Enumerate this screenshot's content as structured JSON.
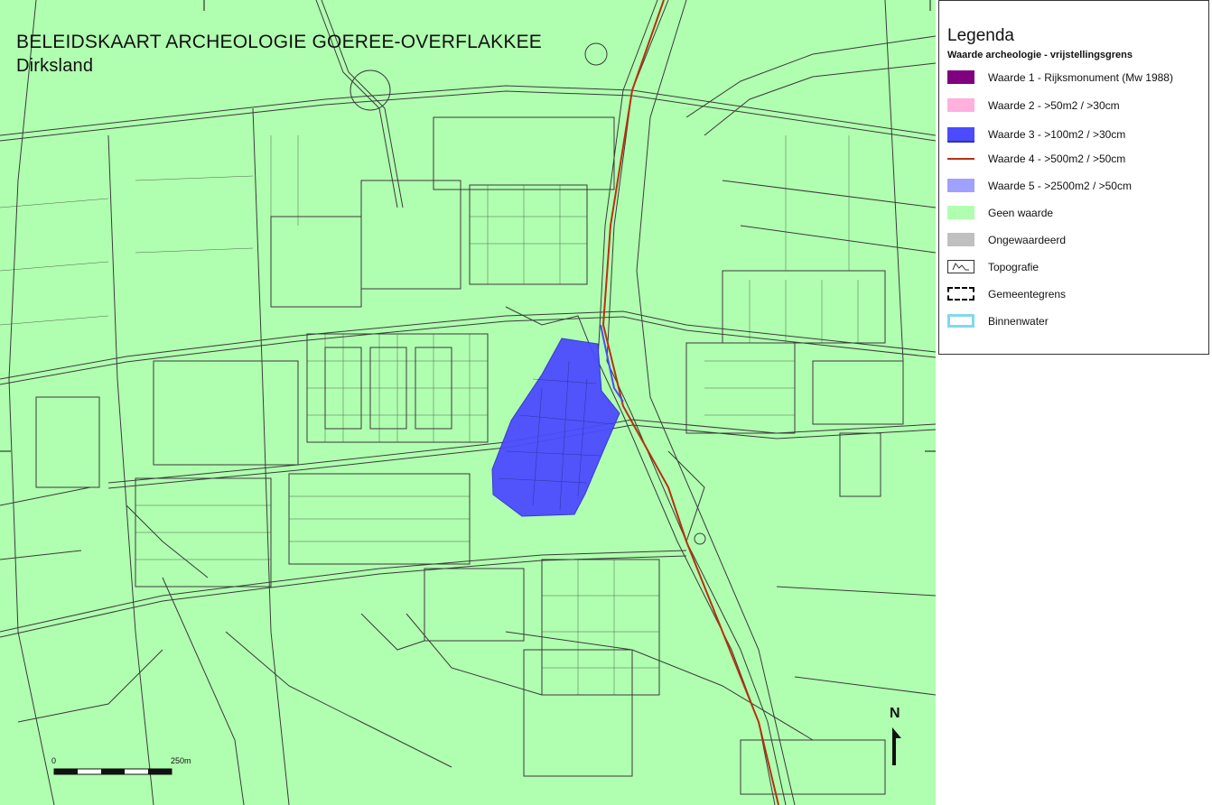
{
  "map": {
    "title": "BELEIDSKAART ARCHEOLOGIE GOEREE-OVERFLAKKEE",
    "subtitle": "Dirksland",
    "background_color": "#b0ffb0",
    "line_color": "#3a3a3a",
    "scale": {
      "start_label": "0",
      "end_label": "250m"
    },
    "north_label": "N"
  },
  "legend": {
    "title": "Legenda",
    "subtitle": "Waarde archeologie - vrijstellingsgrens",
    "items": [
      {
        "label": "Waarde 1 - Rijksmonument (Mw 1988)",
        "color": "#800080",
        "icon": "solid-swatch"
      },
      {
        "label": "Waarde 2 - >50m2 / >30cm",
        "color": "#ffb0dd",
        "icon": "solid-swatch"
      },
      {
        "label": "Waarde 3 - >100m2 / >30cm",
        "color": "#4b4bff",
        "icon": "swatch-with-underline"
      },
      {
        "label": "Waarde 4 - >500m2 / >50cm",
        "color": "#b83010",
        "icon": "line-swatch"
      },
      {
        "label": "Waarde 5 - >2500m2 / >50cm",
        "color": "#a0a0ff",
        "icon": "solid-swatch"
      },
      {
        "label": "Geen waarde",
        "color": "#b0ffb0",
        "icon": "solid-swatch"
      },
      {
        "label": "Ongewaardeerd",
        "color": "#c0c0c0",
        "icon": "solid-swatch"
      },
      {
        "label": "Topografie",
        "color": "#ffffff",
        "icon": "topography-symbol"
      },
      {
        "label": "Gemeentegrens",
        "color": "#000000",
        "icon": "dashed-border-swatch"
      },
      {
        "label": "Binnenwater",
        "color": "#80d8f0",
        "icon": "outline-swatch"
      }
    ]
  }
}
